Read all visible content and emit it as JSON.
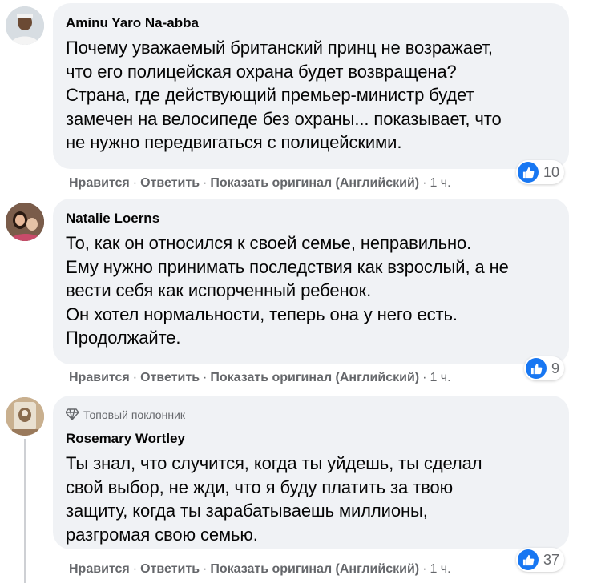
{
  "comments": [
    {
      "author": "Aminu Yaro Na-abba",
      "text": "Почему уважаемый британский принц не возражает,\nчто его полицейская охрана будет возвращена?\nСтрана, где действующий премьер-министр будет\nзамечен на велосипеде без охраны... показывает, что\nне нужно передвигаться с полицейскими.",
      "like_label": "Нравится",
      "reply_label": "Ответить",
      "translate_label": "Показать оригинал (Английский)",
      "time": "1 ч.",
      "reactions_count": "10"
    },
    {
      "author": "Natalie Loerns",
      "text": "То, как он относился к своей семье, неправильно.\nЕму нужно принимать последствия как взрослый, а не\nвести себя как испорченный ребенок.\nОн хотел нормальности, теперь она у него есть.\nПродолжайте.",
      "like_label": "Нравится",
      "reply_label": "Ответить",
      "translate_label": "Показать оригинал (Английский)",
      "time": "1 ч.",
      "reactions_count": "9"
    },
    {
      "badge": "Топовый поклонник",
      "author": "Rosemary Wortley",
      "text": "Ты знал, что случится, когда ты уйдешь, ты сделал\nсвой выбор, не жди, что я буду платить за твою\nзащиту, когда ты зарабатываешь миллионы,\nразгромая свою семью.",
      "like_label": "Нравится",
      "reply_label": "Ответить",
      "translate_label": "Показать оригинал (Английский)",
      "time": "1 ч.",
      "reactions_count": "37"
    }
  ],
  "icons": {
    "like": "thumbs-up-icon",
    "badge": "diamond-icon"
  },
  "colors": {
    "bubble": "#f0f2f5",
    "like_blue": "#1877f2",
    "secondary_text": "#65676b"
  }
}
